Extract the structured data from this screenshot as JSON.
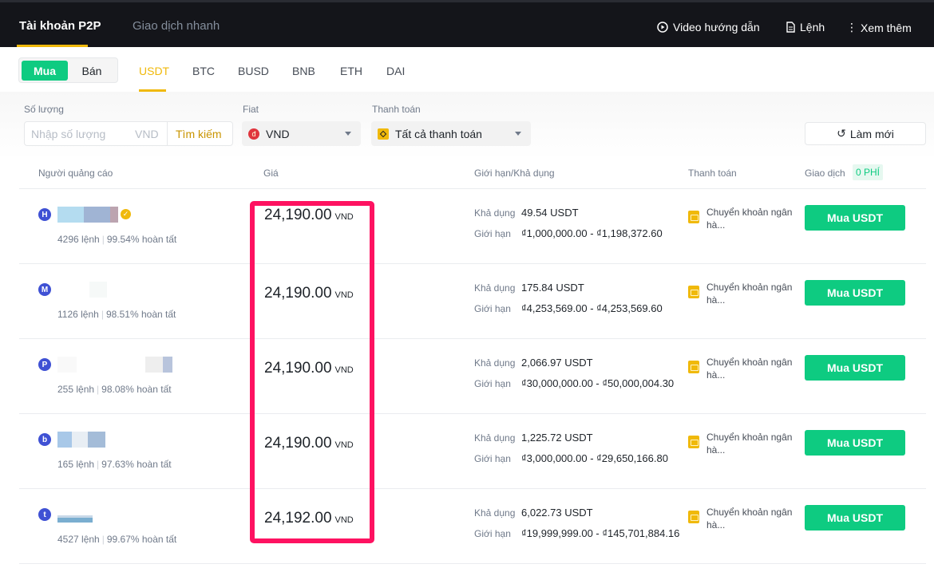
{
  "header": {
    "tabs": [
      "Tài khoản P2P",
      "Giao dịch nhanh"
    ],
    "video_label": "Video hướng dẫn",
    "orders_label": "Lệnh",
    "more_label": "Xem thêm"
  },
  "subnav": {
    "buy": "Mua",
    "sell": "Bán",
    "coins": [
      "USDT",
      "BTC",
      "BUSD",
      "BNB",
      "ETH",
      "DAI"
    ],
    "active_coin": "USDT"
  },
  "filters": {
    "amount_label": "Số lượng",
    "amount_placeholder": "Nhập số lượng",
    "amount_currency": "VND",
    "search_label": "Tìm kiếm",
    "fiat_label": "Fiat",
    "fiat_value": "VND",
    "payment_label": "Thanh toán",
    "payment_value": "Tất cả thanh toán",
    "refresh_label": "Làm mới"
  },
  "table": {
    "headers": [
      "Người quảng cáo",
      "Giá",
      "Giới hạn/Khả dụng",
      "Thanh toán",
      "Giao dịch"
    ],
    "fee_badge": "0 PHÍ",
    "available_label": "Khả dụng",
    "limit_label": "Giới hạn",
    "rows": [
      {
        "initial": "H",
        "orders": "4296 lệnh",
        "completion": "99.54% hoàn tất",
        "price": "24,190.00",
        "currency": "VND",
        "available": "49.54 USDT",
        "limit": "₫1,000,000.00 - ₫1,198,372.60",
        "payment": "Chuyển khoản ngân hà...",
        "action": "Mua USDT",
        "verified": true
      },
      {
        "initial": "M",
        "orders": "1126 lệnh",
        "completion": "98.51% hoàn tất",
        "price": "24,190.00",
        "currency": "VND",
        "available": "175.84 USDT",
        "limit": "₫4,253,569.00 - ₫4,253,569.60",
        "payment": "Chuyển khoản ngân hà...",
        "action": "Mua USDT"
      },
      {
        "initial": "P",
        "orders": "255 lệnh",
        "completion": "98.08% hoàn tất",
        "price": "24,190.00",
        "currency": "VND",
        "available": "2,066.97 USDT",
        "limit": "₫30,000,000.00 - ₫50,000,004.30",
        "payment": "Chuyển khoản ngân hà...",
        "action": "Mua USDT"
      },
      {
        "initial": "b",
        "orders": "165 lệnh",
        "completion": "97.63% hoàn tất",
        "price": "24,190.00",
        "currency": "VND",
        "available": "1,225.72 USDT",
        "limit": "₫3,000,000.00 - ₫29,650,166.80",
        "payment": "Chuyển khoản ngân hà...",
        "action": "Mua USDT"
      },
      {
        "initial": "t",
        "orders": "4527 lệnh",
        "completion": "99.67% hoàn tất",
        "price": "24,192.00",
        "currency": "VND",
        "available": "6,022.73 USDT",
        "limit": "₫19,999,999.00 - ₫145,701,884.16",
        "payment": "Chuyển khoản ngân hà...",
        "action": "Mua USDT"
      }
    ]
  },
  "colors": {
    "accent": "#f0b90b",
    "buy": "#0ecb81",
    "highlight": "#fe1261"
  }
}
